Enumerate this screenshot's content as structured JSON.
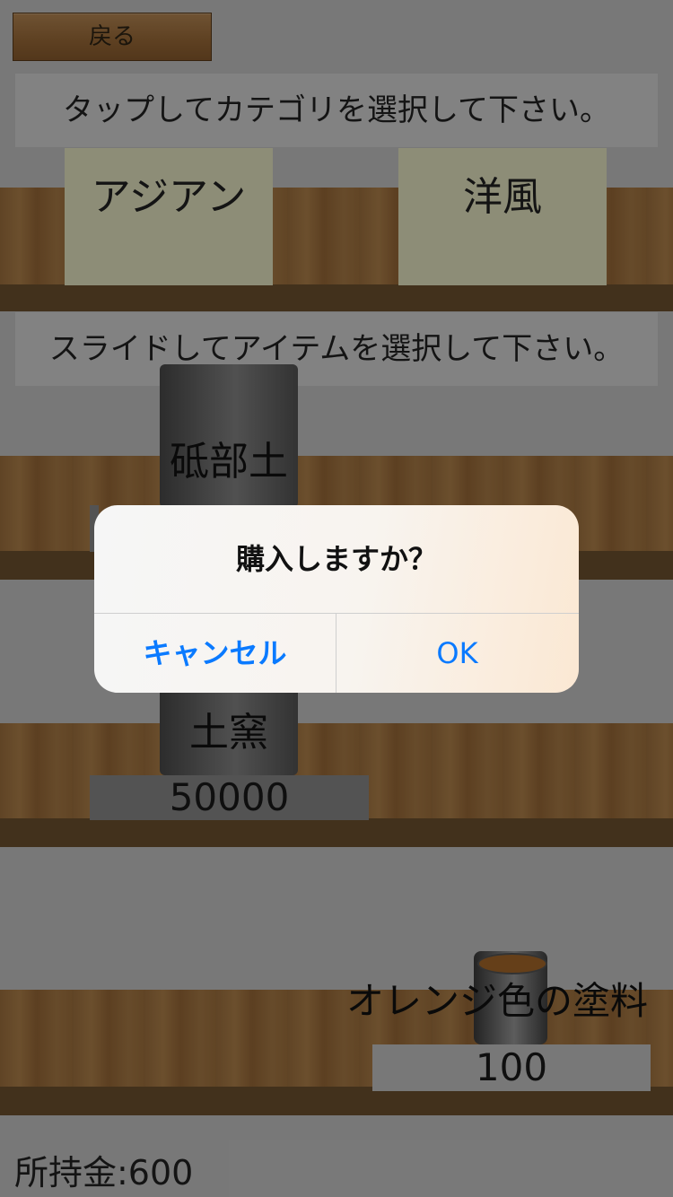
{
  "header": {
    "back_label": "戻る"
  },
  "category_section": {
    "instruction": "タップしてカテゴリを選択して下さい。",
    "categories": [
      {
        "label": "アジアン"
      },
      {
        "label": "洋風"
      }
    ]
  },
  "item_section": {
    "instruction": "スライドしてアイテムを選択して下さい。",
    "items": [
      {
        "label": "砥部土"
      },
      {
        "label": "土窯",
        "price": "50000"
      },
      {
        "label": "オレンジ色の塗料",
        "price": "100"
      }
    ]
  },
  "footer": {
    "money": "所持金:600"
  },
  "dialog": {
    "title": "購入しますか？",
    "cancel_label": "キャンセル",
    "ok_label": "OK",
    "accent_color": "#0a7aff"
  }
}
